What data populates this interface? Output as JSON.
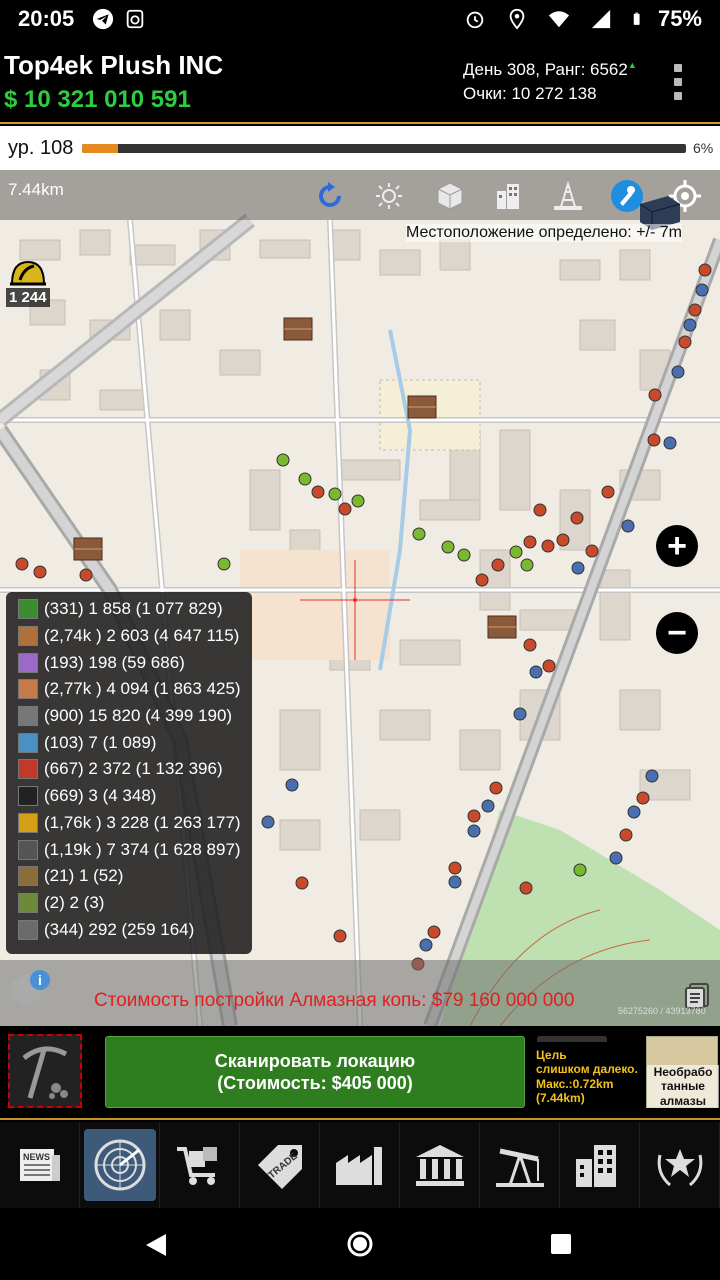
{
  "status_bar": {
    "time": "20:05",
    "battery": "75%",
    "icons": [
      "telegram-icon",
      "app-icon",
      "alarm-icon",
      "location-icon",
      "wifi-icon",
      "signal-icon",
      "battery-icon"
    ]
  },
  "header": {
    "company": "Top4ek Plush INC",
    "money": "$ 10 321 010 591",
    "day_rank": "День 308, Ранг: 6562",
    "points": "Очки: 10 272 138"
  },
  "level": {
    "label": "ур. 108",
    "progress_percent": 6,
    "progress_text": "6%"
  },
  "map": {
    "distance": "7.44km",
    "location_text": "Местоположение определено: +/- 7m",
    "helmet_count": "1 244",
    "toolbar_icons": [
      "refresh-icon",
      "sun-icon",
      "blocks-icon",
      "buildings-icon",
      "oil-rig-icon",
      "tool-icon",
      "locate-icon"
    ],
    "zoom_in": "+",
    "zoom_out": "−"
  },
  "resources": [
    {
      "icon": "res-grass-icon",
      "color": "#3c8d2f",
      "text": "(331) 1 858 (1 077 829)"
    },
    {
      "icon": "res-wood-icon",
      "color": "#b0703a",
      "text": "(2,74k ) 2 603 (4 647 115)"
    },
    {
      "icon": "res-gems-icon",
      "color": "#9b6ac9",
      "text": "(193) 198 (59 686)"
    },
    {
      "icon": "res-clay-icon",
      "color": "#c77a4a",
      "text": "(2,77k ) 4 094 (1 863 425)"
    },
    {
      "icon": "res-tools-icon",
      "color": "#777777",
      "text": "(900) 15 820 (4 399 190)"
    },
    {
      "icon": "res-water-icon",
      "color": "#4a90c2",
      "text": "(103) 7 (1 089)"
    },
    {
      "icon": "res-fabric-icon",
      "color": "#c0392b",
      "text": "(667) 2 372 (1 132 396)"
    },
    {
      "icon": "res-coal-icon",
      "color": "#222222",
      "text": "(669) 3 (4 348)"
    },
    {
      "icon": "res-gold-icon",
      "color": "#d4a017",
      "text": "(1,76k ) 3 228 (1 263 177)"
    },
    {
      "icon": "res-gear-icon",
      "color": "#555555",
      "text": "(1,19k ) 7 374 (1 628 897)"
    },
    {
      "icon": "res-worker1-icon",
      "color": "#8a6d3b",
      "text": "(21) 1 (52)"
    },
    {
      "icon": "res-worker2-icon",
      "color": "#6d8a3b",
      "text": "(2) 2 (3)"
    },
    {
      "icon": "res-worker3-icon",
      "color": "#6b6b6b",
      "text": "(344) 292 (259 164)"
    }
  ],
  "build_cost": {
    "text": "Стоимость постройки Алмазная копь: $79 160 000 000",
    "coords": "56275260 / 43913780"
  },
  "actions": {
    "scan_line1": "Сканировать локацию",
    "scan_line2": "(Стоимость: $405 000)",
    "target_line1": "Цель",
    "target_line2": "слишком далеко.",
    "target_line3": "Макс.:0.72km",
    "target_line4": "(7.44km)",
    "diamond_line1": "Необрабо",
    "diamond_line2": "танные",
    "diamond_line3": "алмазы"
  },
  "bottom_nav": [
    "news-icon",
    "radar-icon",
    "cart-icon",
    "trade-icon",
    "factory-icon",
    "bank-icon",
    "oil-pump-icon",
    "buildings-nav-icon",
    "awards-icon"
  ],
  "colors": {
    "money": "#2ecc40",
    "accent": "#d99a2b",
    "scan_button": "#2e7d1f",
    "warning": "#e02020",
    "target_text": "#f3c21a"
  }
}
